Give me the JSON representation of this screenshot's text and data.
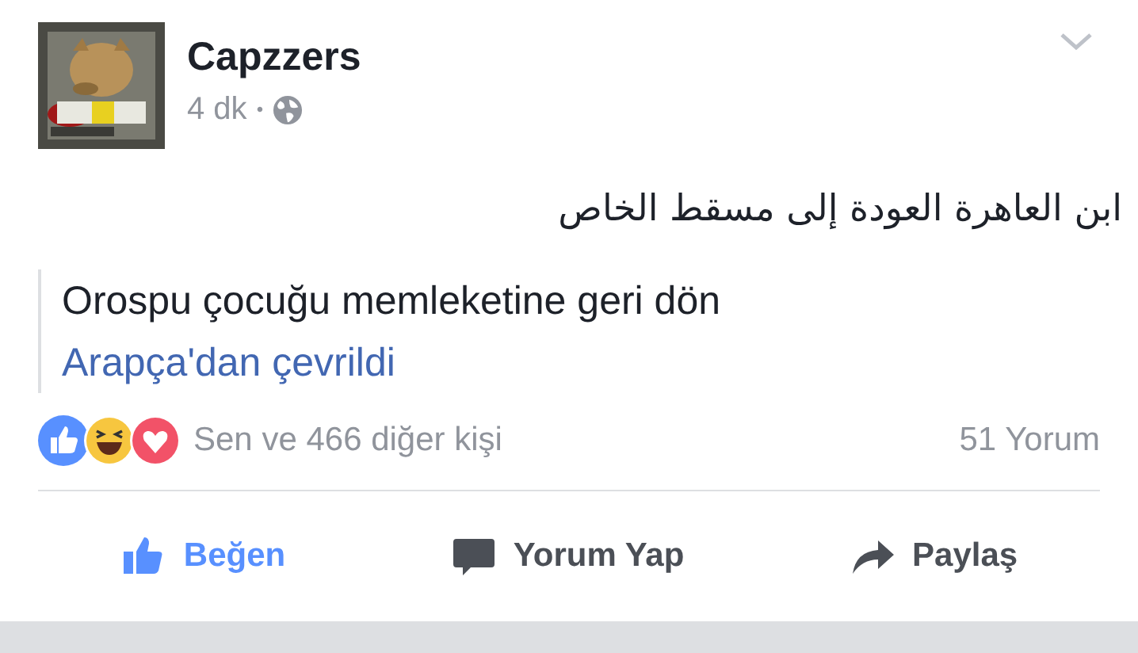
{
  "post": {
    "author": "Capzzers",
    "time": "4 dk",
    "separator": "•",
    "public": true,
    "text": "ابن العاهرة العودة إلى مسقط الخاص",
    "translation": {
      "text": "Orospu çocuğu memleketine geri dön",
      "note": "Arapça'dan çevrildi"
    },
    "reactions": {
      "summary": "Sen ve 466 diğer kişi",
      "comments": "51 Yorum"
    },
    "actions": [
      {
        "kind": "like",
        "label": "Beğen",
        "selected": true
      },
      {
        "kind": "comment",
        "label": "Yorum Yap",
        "selected": false
      },
      {
        "kind": "share",
        "label": "Paylaş",
        "selected": false
      }
    ]
  }
}
